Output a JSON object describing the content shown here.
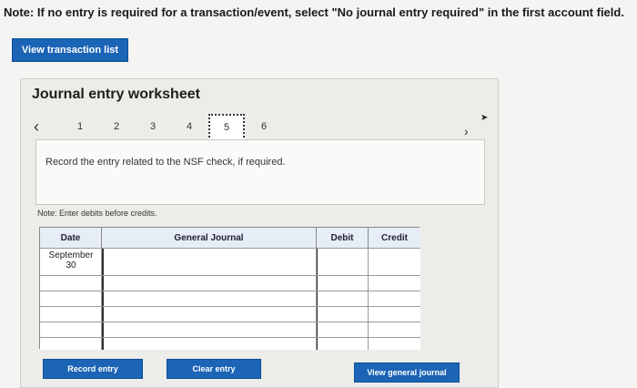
{
  "header": {
    "note": "Note: If no entry is required for a transaction/event, select \"No journal entry required\" in the first account field.",
    "view_transaction_label": "View transaction list"
  },
  "worksheet": {
    "title": "Journal entry worksheet",
    "pages": [
      "1",
      "2",
      "3",
      "4",
      "5",
      "6"
    ],
    "active_page": "5",
    "instruction": "Record the entry related to the NSF check, if required.",
    "note_debits": "Note: Enter debits before credits.",
    "columns": [
      "Date",
      "General Journal",
      "Debit",
      "Credit"
    ],
    "date_value_line1": "September",
    "date_value_line2": "30",
    "buttons": {
      "record": "Record entry",
      "clear": "Clear entry",
      "view_general": "View general journal"
    }
  }
}
